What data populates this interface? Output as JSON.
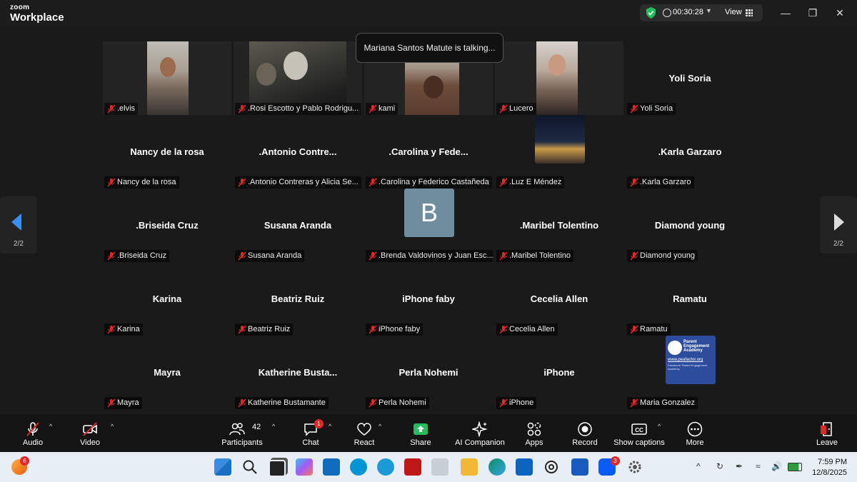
{
  "app": {
    "brand_top": "zoom",
    "brand_bottom": "Workplace"
  },
  "status": {
    "timer": "00:30:28",
    "view_label": "View"
  },
  "talking_notice": "Mariana Santos Matute is talking...",
  "pagination": {
    "left": "2/2",
    "right": "2/2"
  },
  "tiles": [
    {
      "display": "",
      "label": ".elvis"
    },
    {
      "display": "",
      "label": ".Rosi Escotto y Pablo Rodrigu..."
    },
    {
      "display": "",
      "label": "kami"
    },
    {
      "display": "",
      "label": "Lucero"
    },
    {
      "display": "Yoli Soria",
      "label": "Yoli Soria"
    },
    {
      "display": "Nancy de la rosa",
      "label": "Nancy de la rosa"
    },
    {
      "display": ".Antonio  Contre...",
      "label": ".Antonio Contreras y Alicia Se..."
    },
    {
      "display": ".Carolina  y  Fede...",
      "label": ".Carolina y Federico Castañeda"
    },
    {
      "display": "",
      "label": ".Luz E Méndez"
    },
    {
      "display": ".Karla Garzaro",
      "label": ".Karla Garzaro"
    },
    {
      "display": ".Briseida Cruz",
      "label": ".Briseida Cruz"
    },
    {
      "display": "Susana Aranda",
      "label": "Susana Aranda"
    },
    {
      "display": "B",
      "label": ".Brenda Valdovinos y Juan Esc..."
    },
    {
      "display": ".Maribel Tolentino",
      "label": ".Maribel Tolentino"
    },
    {
      "display": "Diamond young",
      "label": "Diamond young"
    },
    {
      "display": "Karina",
      "label": "Karina"
    },
    {
      "display": "Beatriz Ruiz",
      "label": "Beatriz Ruiz"
    },
    {
      "display": "iPhone faby",
      "label": "iPhone faby"
    },
    {
      "display": "Cecelia Allen",
      "label": "Cecelia Allen"
    },
    {
      "display": "Ramatu",
      "label": "Ramatu"
    },
    {
      "display": "Mayra",
      "label": "Mayra"
    },
    {
      "display": "Katherine  Busta...",
      "label": "Katherine Bustamante"
    },
    {
      "display": "Perla Nohemi",
      "label": "Perla Nohemi"
    },
    {
      "display": "iPhone",
      "label": "iPhone"
    },
    {
      "display": "",
      "label": "Maria Gonzalez"
    }
  ],
  "pea_logo": {
    "line1": "Parent",
    "line2": "Engagement",
    "line3": "Academy",
    "url": "www.peafactor.org",
    "fb": "Facebook: Parent Engagement Academy"
  },
  "toolbar": {
    "audio": "Audio",
    "video": "Video",
    "participants": "Participants",
    "participants_count": "42",
    "chat": "Chat",
    "chat_badge": "1",
    "react": "React",
    "share": "Share",
    "ai_companion": "AI Companion",
    "apps": "Apps",
    "record": "Record",
    "show_captions": "Show captions",
    "more": "More",
    "leave": "Leave"
  },
  "taskbar": {
    "weather_badge": "6",
    "zoom_badge": "3",
    "time": "7:59 PM",
    "date": "12/8/2025"
  },
  "colors": {
    "mic_off_red": "#e02828",
    "share_green": "#1fbf5f",
    "toolbar_bg": "#141414",
    "meeting_bg": "#1a1a1a"
  }
}
